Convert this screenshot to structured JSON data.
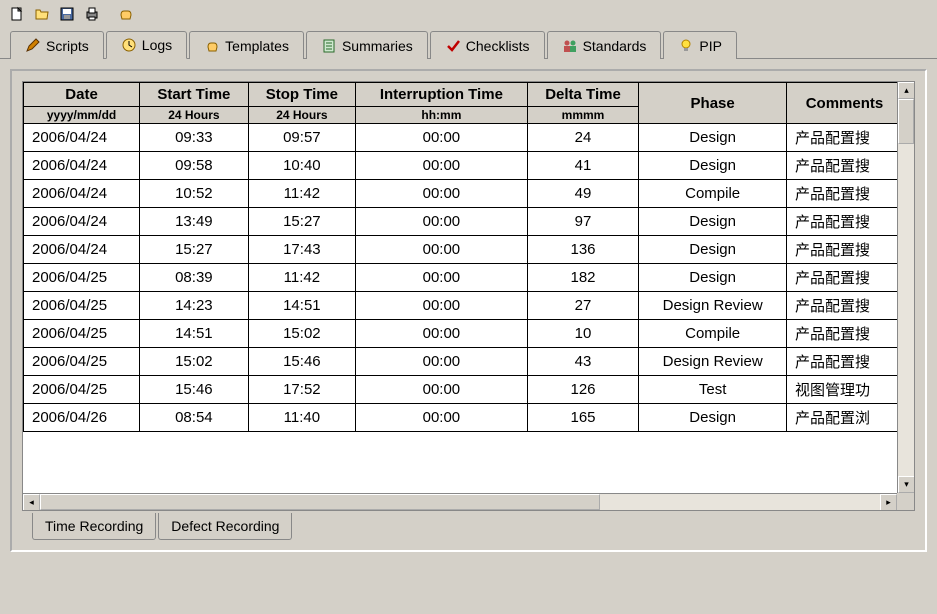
{
  "toolbar": {
    "new": "New",
    "open": "Open",
    "save": "Save",
    "print": "Print",
    "run": "Run"
  },
  "tabs_top": [
    {
      "label": "Scripts",
      "icon": "pencil"
    },
    {
      "label": "Logs",
      "icon": "clock"
    },
    {
      "label": "Templates",
      "icon": "hand"
    },
    {
      "label": "Summaries",
      "icon": "sheet"
    },
    {
      "label": "Checklists",
      "icon": "check"
    },
    {
      "label": "Standards",
      "icon": "people"
    },
    {
      "label": "PIP",
      "icon": "bulb"
    }
  ],
  "active_top_tab": "Logs",
  "tabs_bottom": [
    {
      "label": "Time Recording"
    },
    {
      "label": "Defect Recording"
    }
  ],
  "active_bottom_tab": "Time Recording",
  "table": {
    "headers": [
      {
        "label": "Date",
        "sub": "yyyy/mm/dd"
      },
      {
        "label": "Start Time",
        "sub": "24 Hours"
      },
      {
        "label": "Stop Time",
        "sub": "24 Hours"
      },
      {
        "label": "Interruption Time",
        "sub": "hh:mm"
      },
      {
        "label": "Delta Time",
        "sub": "mmmm"
      },
      {
        "label": "Phase",
        "sub": ""
      },
      {
        "label": "Comments",
        "sub": ""
      }
    ],
    "rows": [
      {
        "date": "2006/04/24",
        "start": "09:33",
        "stop": "09:57",
        "int": "00:00",
        "delta": "24",
        "phase": "Design",
        "comment": "产品配置搜"
      },
      {
        "date": "2006/04/24",
        "start": "09:58",
        "stop": "10:40",
        "int": "00:00",
        "delta": "41",
        "phase": "Design",
        "comment": "产品配置搜"
      },
      {
        "date": "2006/04/24",
        "start": "10:52",
        "stop": "11:42",
        "int": "00:00",
        "delta": "49",
        "phase": "Compile",
        "comment": "产品配置搜"
      },
      {
        "date": "2006/04/24",
        "start": "13:49",
        "stop": "15:27",
        "int": "00:00",
        "delta": "97",
        "phase": "Design",
        "comment": "产品配置搜"
      },
      {
        "date": "2006/04/24",
        "start": "15:27",
        "stop": "17:43",
        "int": "00:00",
        "delta": "136",
        "phase": "Design",
        "comment": "产品配置搜"
      },
      {
        "date": "2006/04/25",
        "start": "08:39",
        "stop": "11:42",
        "int": "00:00",
        "delta": "182",
        "phase": "Design",
        "comment": "产品配置搜"
      },
      {
        "date": "2006/04/25",
        "start": "14:23",
        "stop": "14:51",
        "int": "00:00",
        "delta": "27",
        "phase": "Design Review",
        "comment": "产品配置搜"
      },
      {
        "date": "2006/04/25",
        "start": "14:51",
        "stop": "15:02",
        "int": "00:00",
        "delta": "10",
        "phase": "Compile",
        "comment": "产品配置搜"
      },
      {
        "date": "2006/04/25",
        "start": "15:02",
        "stop": "15:46",
        "int": "00:00",
        "delta": "43",
        "phase": "Design Review",
        "comment": "产品配置搜"
      },
      {
        "date": "2006/04/25",
        "start": "15:46",
        "stop": "17:52",
        "int": "00:00",
        "delta": "126",
        "phase": "Test",
        "comment": "视图管理功"
      },
      {
        "date": "2006/04/26",
        "start": "08:54",
        "stop": "11:40",
        "int": "00:00",
        "delta": "165",
        "phase": "Design",
        "comment": "产品配置浏"
      }
    ]
  }
}
